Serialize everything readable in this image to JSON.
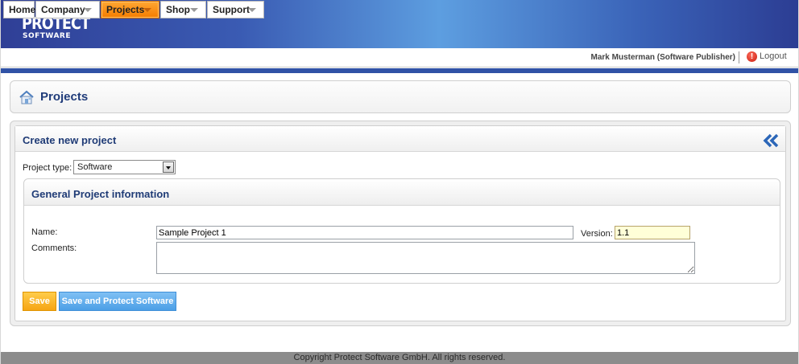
{
  "brand": {
    "line1": "PROTECT",
    "line2": "SOFTWARE"
  },
  "nav": {
    "items": [
      {
        "label": "Home",
        "has_dropdown": false,
        "active": false
      },
      {
        "label": "Company",
        "has_dropdown": true,
        "active": false
      },
      {
        "label": "Projects",
        "has_dropdown": true,
        "active": true
      },
      {
        "label": "Shop",
        "has_dropdown": true,
        "active": false
      },
      {
        "label": "Support",
        "has_dropdown": true,
        "active": false
      }
    ],
    "user": "Mark Musterman (Software Publisher)",
    "logout_label": "Logout",
    "logout_icon": "!"
  },
  "page": {
    "title": "Projects",
    "icon": "home-icon"
  },
  "form": {
    "heading": "Create new project",
    "project_type_label": "Project type:",
    "project_type_value": "Software",
    "group_heading": "General Project information",
    "name_label": "Name:",
    "name_value": "Sample Project 1",
    "version_label": "Version:",
    "version_value": "1.1",
    "comments_label": "Comments:",
    "comments_value": "",
    "save_label": "Save",
    "save_protect_label": "Save and Protect Software"
  },
  "footer": {
    "copyright": "Copyright Protect Software GmbH. All rights reserved."
  },
  "colors": {
    "accent_orange": "#f47c00",
    "brand_blue": "#3052a6",
    "title_blue": "#1f3b76",
    "button_blue": "#4c9fe6",
    "button_orange": "#f6a514"
  }
}
